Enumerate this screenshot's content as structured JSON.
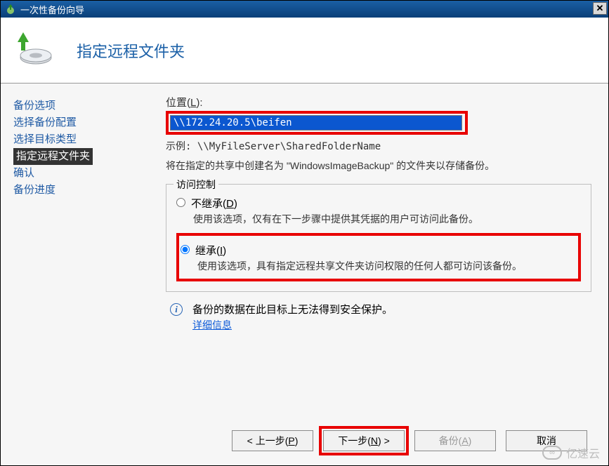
{
  "window": {
    "title": "一次性备份向导"
  },
  "header": {
    "page_title": "指定远程文件夹"
  },
  "sidebar": {
    "steps": [
      "备份选项",
      "选择备份配置",
      "选择目标类型",
      "指定远程文件夹",
      "确认",
      "备份进度"
    ],
    "current_index": 3
  },
  "main": {
    "location_label_prefix": "位置(",
    "location_label_key": "L",
    "location_label_suffix": "):",
    "location_value": "\\\\172.24.20.5\\beifen",
    "example_prefix": "示例:  ",
    "example_path": "\\\\MyFileServer\\SharedFolderName",
    "description": "将在指定的共享中创建名为 \"WindowsImageBackup\" 的文件夹以存储备份。",
    "ac_legend": "访问控制",
    "radio_no_inherit_prefix": "不继承(",
    "radio_no_inherit_key": "D",
    "radio_no_inherit_suffix": ")",
    "radio_no_inherit_desc": "使用该选项，仅有在下一步骤中提供其凭据的用户可访问此备份。",
    "radio_inherit_prefix": "继承(",
    "radio_inherit_key": "I",
    "radio_inherit_suffix": ")",
    "radio_inherit_desc": "使用该选项，具有指定远程共享文件夹访问权限的任何人都可访问该备份。",
    "info_text": "备份的数据在此目标上无法得到安全保护。",
    "info_link": "详细信息"
  },
  "buttons": {
    "prev_prefix": "< 上一步(",
    "prev_key": "P",
    "prev_suffix": ")",
    "next_prefix": "下一步(",
    "next_key": "N",
    "next_suffix": ") >",
    "backup_prefix": "备份(",
    "backup_key": "A",
    "backup_suffix": ")",
    "cancel": "取消"
  },
  "watermark": {
    "text": "亿速云"
  }
}
